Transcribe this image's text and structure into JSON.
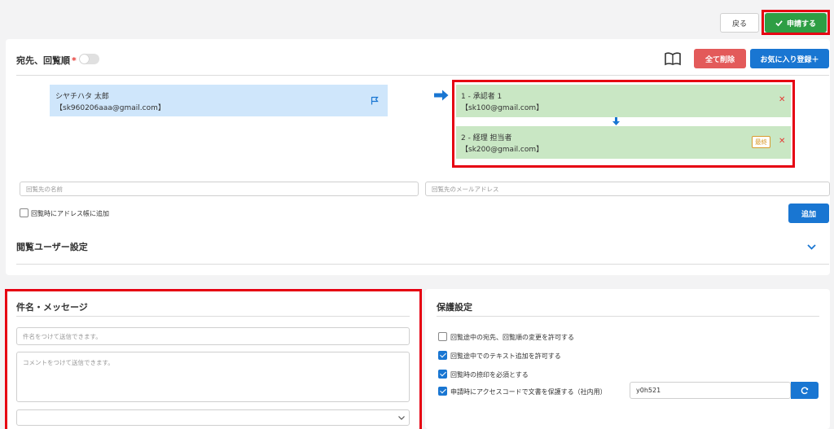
{
  "toolbar": {
    "back_label": "戻る",
    "apply_label": "申請する"
  },
  "recipients_section": {
    "title": "宛先、回覧順",
    "required_mark": "*",
    "clear_all_label": "全て削除",
    "favorite_label": "お気に入り登録＋",
    "sender": {
      "name": "シヤチハタ 太郎",
      "email": "【sk960206aaa@gmail.com】"
    },
    "recipients": [
      {
        "title": "1 - 承認者 1",
        "email": "【sk100@gmail.com】"
      },
      {
        "title": "2 - 経理 担当者",
        "email": "【sk200@gmail.com】",
        "badge": "最終"
      }
    ],
    "name_placeholder": "回覧先の名前",
    "email_placeholder": "回覧先のメールアドレス",
    "add_to_address_book_label": "回覧時にアドレス帳に追加",
    "add_label": "追加",
    "viewer_settings_label": "閲覧ユーザー設定"
  },
  "message_section": {
    "title": "件名・メッセージ",
    "subject_placeholder": "件名をつけて送信できます。",
    "comment_placeholder": "コメントをつけて送信できます。"
  },
  "protection_section": {
    "title": "保護設定",
    "options": [
      {
        "label": "回覧途中の宛先、回覧順の変更を許可する",
        "checked": false
      },
      {
        "label": "回覧途中でのテキスト追加を許可する",
        "checked": true
      },
      {
        "label": "回覧時の捺印を必須とする",
        "checked": true
      },
      {
        "label": "申請時にアクセスコードで文書を保護する（社内用）",
        "checked": true
      }
    ],
    "access_code_value": "y0h521"
  },
  "colors": {
    "apply_green": "#2e9e44",
    "primary_blue": "#1976d2",
    "danger_red": "#e35a5a",
    "sender_blue": "#cfe6fb",
    "recipient_green": "#c9e7c4",
    "highlight_red": "#e60012"
  }
}
